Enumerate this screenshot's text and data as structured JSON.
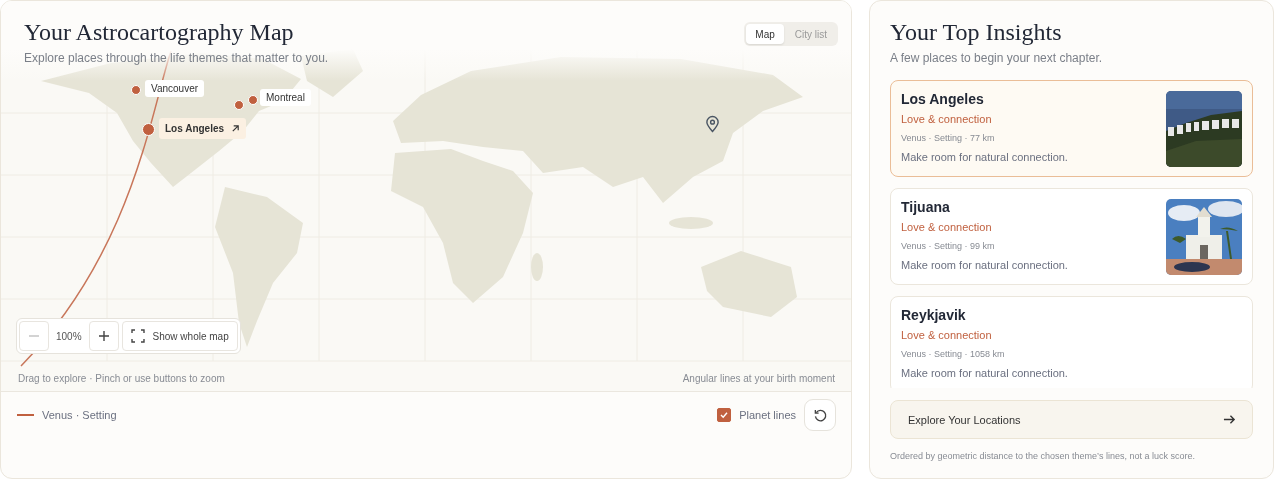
{
  "map_panel": {
    "title": "Your Astrocartography Map",
    "subtitle": "Explore places through the life themes that matter to you.",
    "view_tabs": [
      {
        "label": "Map",
        "selected": true
      },
      {
        "label": "City list",
        "selected": false
      }
    ],
    "pins": [
      {
        "label": "Vancouver",
        "selected": false
      },
      {
        "selected": false
      },
      {
        "label": "Montreal",
        "selected": false
      },
      {
        "label": "Los Angeles",
        "selected": true
      }
    ],
    "zoom": {
      "value": "100%",
      "fit_label": "Show whole map"
    },
    "hint": "Drag to explore · Pinch or use buttons to zoom",
    "caption": "Angular lines at your birth moment",
    "legend": [
      {
        "label": "Venus · Setting",
        "color": "#c0603f"
      }
    ],
    "planet_lines": {
      "label": "Planet lines",
      "checked": true
    }
  },
  "insights": {
    "title": "Your Top Insights",
    "subtitle": "A few places to begin your next chapter.",
    "items": [
      {
        "name": "Los Angeles",
        "theme": "Love & connection",
        "meta": "Venus · Setting · 77 km",
        "note": "Make room for natural connection.",
        "selected": true,
        "kind": "picture"
      },
      {
        "name": "Tijuana",
        "theme": "Love & connection",
        "meta": "Venus · Setting · 99 km",
        "note": "Make room for natural connection.",
        "selected": false,
        "kind": "picture"
      },
      {
        "name": "Reykjavik",
        "theme": "Love & connection",
        "meta": "Venus · Setting · 1058 km",
        "note": "Make room for natural connection.",
        "selected": false
      }
    ],
    "cta": "Explore Your Locations",
    "footnote": "Ordered by geometric distance to the chosen theme’s lines, not a luck score."
  }
}
